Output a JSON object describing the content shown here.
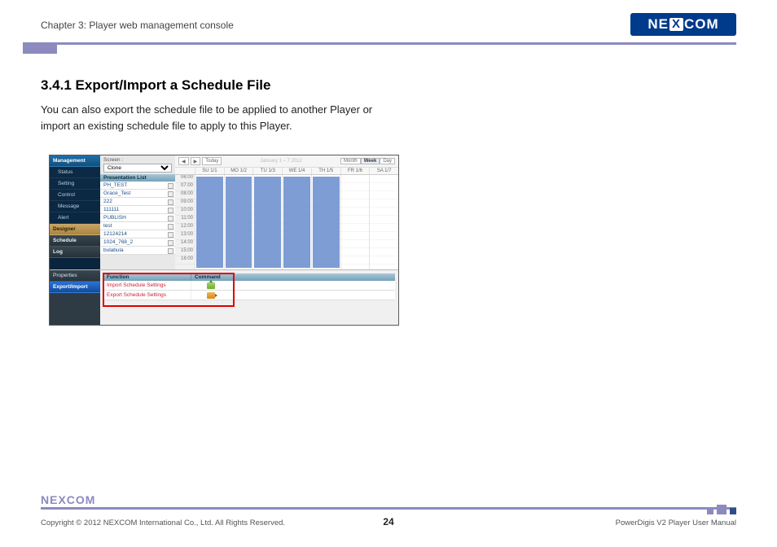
{
  "header": {
    "chapter": "Chapter 3: Player web management console",
    "logo_text": "NEXCOM"
  },
  "section": {
    "title": "3.4.1 Export/Import a Schedule File",
    "body": "You can also export the schedule file to be applied to another Player or import an existing schedule file to apply to this Player."
  },
  "screenshot": {
    "nav": {
      "management": "Management",
      "status": "Status",
      "setting": "Setting",
      "control": "Control",
      "message": "Message",
      "alert": "Alert",
      "designer": "Designer",
      "schedule": "Schedule",
      "log": "Log"
    },
    "screen_label": "Screen :",
    "screen_value": "Clone",
    "pres_header": "Presentation List",
    "pres_items": [
      "PH_TEST",
      "Grace_Test",
      "222",
      "111111",
      "PUBLISH",
      "test",
      "12124214",
      "1024_768_2",
      "bulabula"
    ],
    "cal": {
      "today": "Today",
      "range": "January 1 – 7 2012",
      "views": [
        "Month",
        "Week",
        "Day"
      ],
      "days": [
        "SU 1/1",
        "MO 1/2",
        "TU 1/3",
        "WE 1/4",
        "TH 1/5",
        "FR 1/6",
        "SA 1/7"
      ],
      "hours": [
        "06:00",
        "07:00",
        "08:00",
        "09:00",
        "10:00",
        "11:00",
        "12:00",
        "13:00",
        "14:00",
        "15:00",
        "16:00"
      ]
    },
    "tabs": {
      "properties": "Properties",
      "export_import": "Export/Import"
    },
    "func": {
      "col_function": "Function",
      "col_command": "Command",
      "row_import": "Import Schedule Settings",
      "row_export": "Export Schedule Settings"
    }
  },
  "footer": {
    "logo_text": "NEXCOM",
    "copyright": "Copyright © 2012 NEXCOM International Co., Ltd. All Rights Reserved.",
    "page": "24",
    "manual": "PowerDigis V2 Player User Manual"
  }
}
